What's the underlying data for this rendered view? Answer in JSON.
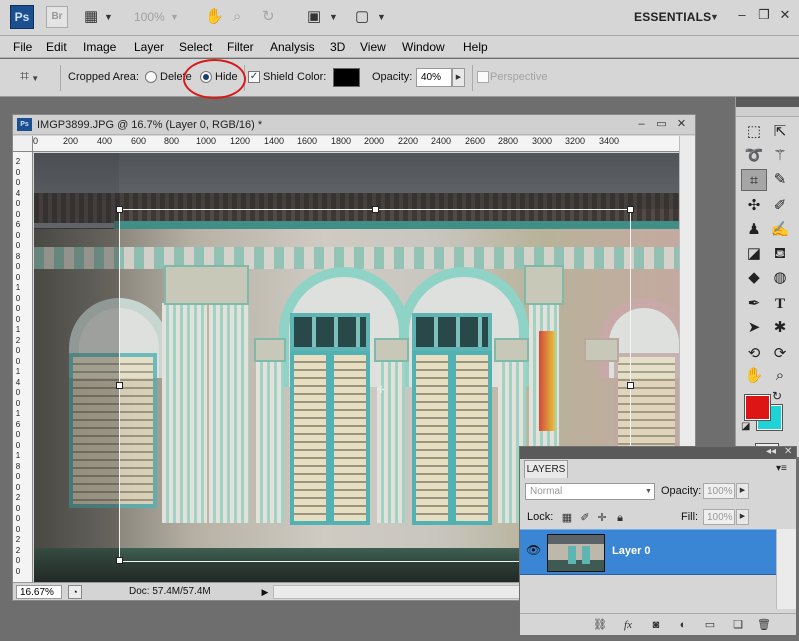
{
  "app_bar": {
    "logo": "Ps",
    "bridge": "Br",
    "zoom": "100%",
    "workspace": "ESSENTIALS",
    "icons": [
      "layout-icon",
      "hand-icon",
      "zoom-icon",
      "rotate-icon",
      "arrange-icon",
      "screen-mode-icon"
    ],
    "window_controls": [
      "minimize-icon",
      "restore-icon",
      "close-icon"
    ]
  },
  "menu": {
    "items": [
      "File",
      "Edit",
      "Image",
      "Layer",
      "Select",
      "Filter",
      "Analysis",
      "3D",
      "View",
      "Window",
      "Help"
    ]
  },
  "options": {
    "tool_icon": "crop-icon",
    "cropped_area_label": "Cropped Area:",
    "delete_label": "Delete",
    "hide_label": "Hide",
    "hide_selected": true,
    "shield_label": "Shield",
    "shield_checked": true,
    "color_label": "Color:",
    "shield_color": "#000000",
    "opacity_label": "Opacity:",
    "opacity_value": "40%",
    "perspective_label": "Perspective",
    "perspective_checked": false,
    "highlight_color": "#d91a1a"
  },
  "document": {
    "title": "IMGP3899.JPG @ 16.7% (Layer 0, RGB/16) *",
    "ruler_top": [
      "0",
      "200",
      "400",
      "600",
      "800",
      "1000",
      "1200",
      "1400",
      "1600",
      "1800",
      "2000",
      "2200",
      "2400",
      "2600",
      "2800",
      "3000",
      "3200",
      "3400"
    ],
    "ruler_left": [
      "2",
      "0",
      "0",
      "4",
      "0",
      "0",
      "6",
      "0",
      "0",
      "8",
      "0",
      "0",
      "1",
      "0",
      "0",
      "0",
      "1",
      "2",
      "0",
      "0",
      "1",
      "4",
      "0",
      "0",
      "1",
      "6",
      "0",
      "0",
      "1",
      "8",
      "0",
      "0",
      "2",
      "0",
      "0",
      "0",
      "2",
      "2",
      "0",
      "0"
    ],
    "zoom": "16.67%",
    "doc_size": "Doc: 57.4M/57.4M"
  },
  "tools": {
    "items": [
      "marquee-icon",
      "move-icon",
      "lasso-icon",
      "magic-wand-icon",
      "crop-icon",
      "eyedropper-icon",
      "healing-icon",
      "brush-icon",
      "clone-stamp-icon",
      "history-brush-icon",
      "eraser-icon",
      "paint-bucket-icon",
      "blur-icon",
      "dodge-icon",
      "pen-icon",
      "type-icon",
      "path-select-icon",
      "shape-icon",
      "3d-rotate-icon",
      "3d-orbit-icon",
      "hand-icon",
      "zoom-icon"
    ],
    "selected": "crop-icon",
    "foreground_color": "#dd1515",
    "background_color": "#1fd3d6"
  },
  "layers": {
    "tab": "LAYERS",
    "blend_mode": "Normal",
    "opacity_label": "Opacity:",
    "opacity_value": "100%",
    "lock_label": "Lock:",
    "fill_label": "Fill:",
    "fill_value": "100%",
    "layer_name": "Layer 0",
    "bottom_icons": [
      "link-icon",
      "fx-icon",
      "mask-icon",
      "adjustment-icon",
      "group-icon",
      "new-layer-icon",
      "trash-icon"
    ]
  }
}
